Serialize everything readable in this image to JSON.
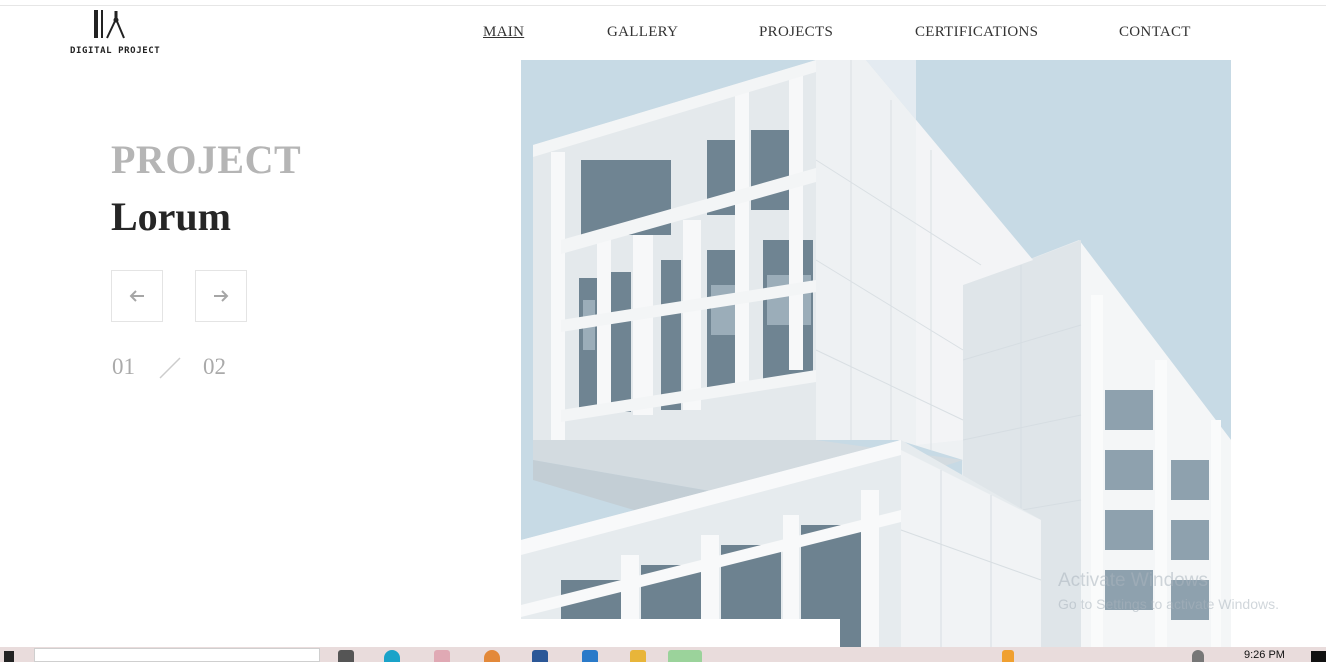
{
  "logo": {
    "icon": "architect-compass-icon",
    "text": "DIGITAL PROJECT"
  },
  "nav": [
    {
      "label": "MAIN",
      "active": true
    },
    {
      "label": "GALLERY",
      "active": false
    },
    {
      "label": "PROJECTS",
      "active": false
    },
    {
      "label": "CERTIFICATIONS",
      "active": false
    },
    {
      "label": "CONTACT",
      "active": false
    }
  ],
  "hero": {
    "eyebrow": "PROJECT",
    "title": "Lorum",
    "prev_icon": "arrow-left-icon",
    "next_icon": "arrow-right-icon",
    "slide_current": "01",
    "slide_total": "02",
    "image": "white-modern-building-photo"
  },
  "watermark": {
    "title": "Activate Windows",
    "subtitle": "Go to Settings to activate Windows."
  },
  "taskbar": {
    "time": "9:26 PM"
  },
  "colors": {
    "eyebrow": "#b5b5b5",
    "title": "#262626",
    "sky": "#c9dbe6",
    "taskbar": "#e9dcdc"
  }
}
